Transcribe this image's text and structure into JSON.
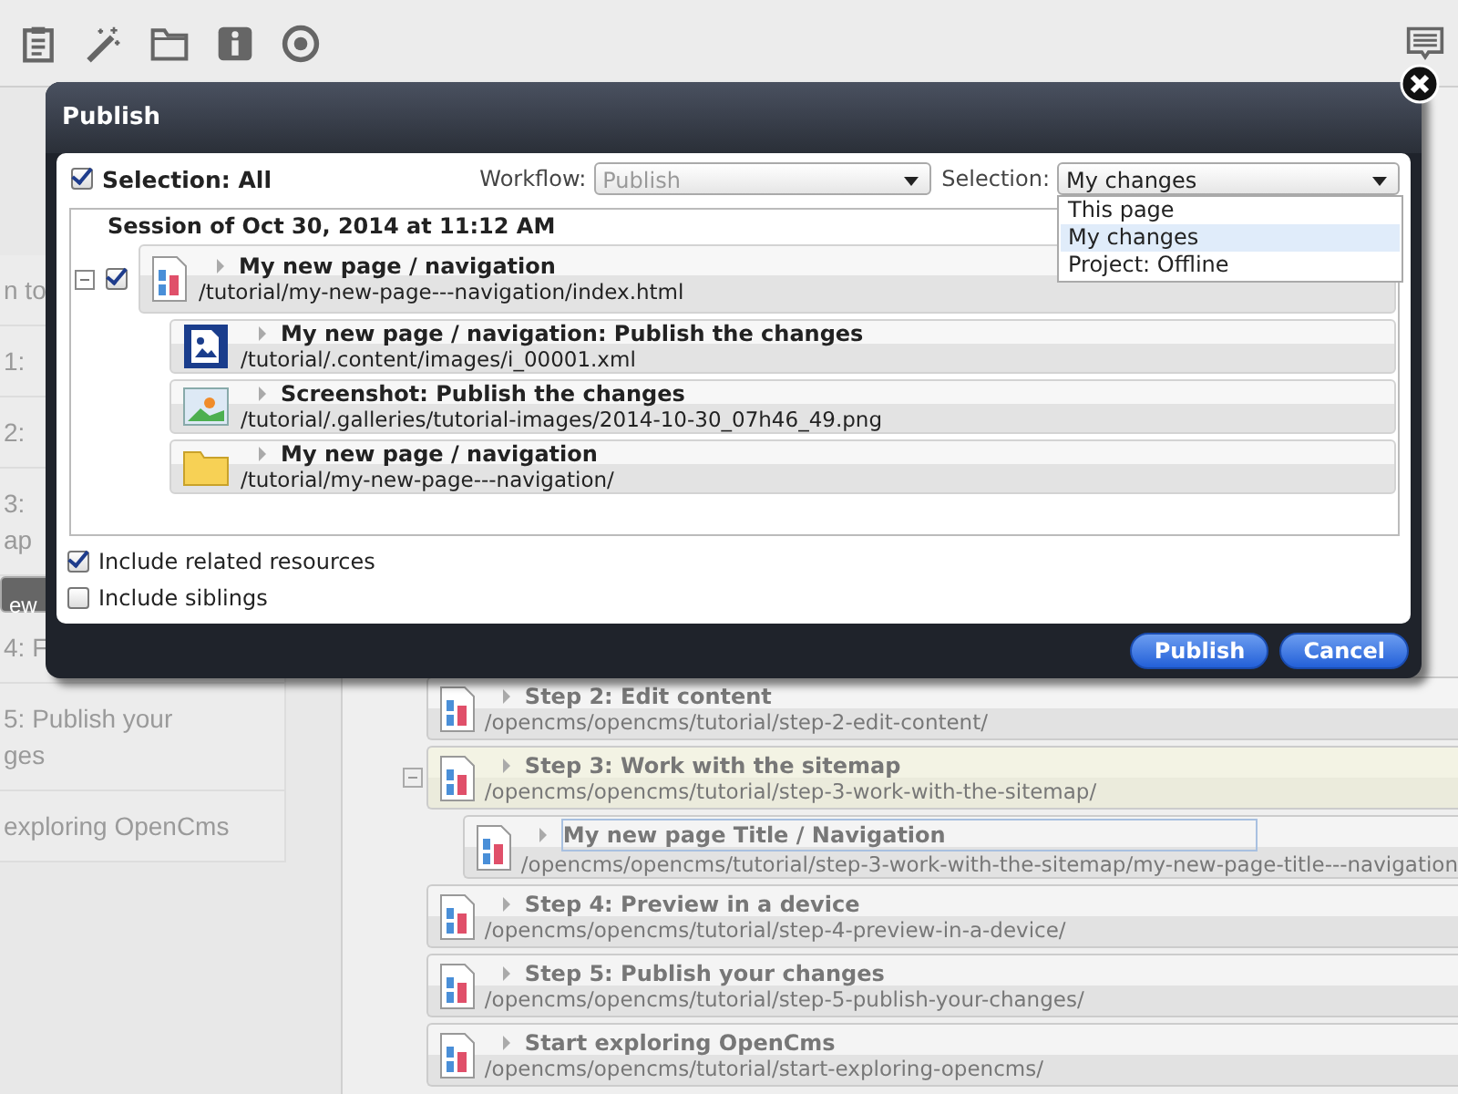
{
  "sidebar": {
    "items": [
      {
        "lines": [
          "n to"
        ],
        "selected": false
      },
      {
        "lines": [
          "1:"
        ],
        "selected": false
      },
      {
        "lines": [
          "2:"
        ],
        "selected": false
      },
      {
        "lines": [
          "3:",
          "ap"
        ],
        "selected": false
      },
      {
        "lines": [
          "ew"
        ],
        "selected": true
      },
      {
        "lines": [
          "4: F"
        ],
        "selected": false
      },
      {
        "lines": [
          "5: Publish your",
          "ges"
        ],
        "selected": false
      },
      {
        "lines": [
          "exploring OpenCms"
        ],
        "selected": false
      }
    ]
  },
  "sitemap": {
    "items": [
      {
        "title": "Step 2: Edit content",
        "path": "/opencms/opencms/tutorial/step-2-edit-content/",
        "expanded": false,
        "highlighted": false
      },
      {
        "title": "Step 3: Work with the sitemap",
        "path": "/opencms/opencms/tutorial/step-3-work-with-the-sitemap/",
        "expanded": true,
        "highlighted": true,
        "children": [
          {
            "title": "My new page Title / Navigation",
            "path": "/opencms/opencms/tutorial/step-3-work-with-the-sitemap/my-new-page-title---navigation",
            "editing": true
          }
        ]
      },
      {
        "title": "Step 4: Preview in a device",
        "path": "/opencms/opencms/tutorial/step-4-preview-in-a-device/",
        "expanded": false,
        "highlighted": false
      },
      {
        "title": "Step 5: Publish your changes",
        "path": "/opencms/opencms/tutorial/step-5-publish-your-changes/",
        "expanded": false,
        "highlighted": false
      },
      {
        "title": "Start exploring OpenCms",
        "path": "/opencms/opencms/tutorial/start-exploring-opencms/",
        "expanded": false,
        "highlighted": false
      }
    ]
  },
  "dialog": {
    "title": "Publish",
    "select_all": {
      "label": "Selection: All",
      "checked": true
    },
    "workflow": {
      "label": "Workflow:",
      "value": "Publish",
      "disabled": true
    },
    "selection": {
      "label": "Selection:",
      "value": "My changes",
      "options": [
        {
          "label": "This page",
          "selected": false
        },
        {
          "label": "My changes",
          "selected": true
        },
        {
          "label": "Project: Offline",
          "selected": false
        }
      ]
    },
    "session": {
      "title": "Session of Oct 30, 2014 at 11:12 AM",
      "expanded": true,
      "checked": true,
      "resource": {
        "kind": "page",
        "title": "My new page / navigation",
        "path": "/tutorial/my-new-page---navigation/index.html"
      },
      "related": [
        {
          "kind": "xml",
          "title": "My new page / navigation: Publish the changes",
          "path": "/tutorial/.content/images/i_00001.xml"
        },
        {
          "kind": "image",
          "title": "Screenshot: Publish the changes",
          "path": "/tutorial/.galleries/tutorial-images/2014-10-30_07h46_49.png"
        },
        {
          "kind": "folder",
          "title": "My new page / navigation",
          "path": "/tutorial/my-new-page---navigation/"
        }
      ]
    },
    "options": [
      {
        "label": "Include related resources",
        "checked": true
      },
      {
        "label": "Include siblings",
        "checked": false
      }
    ],
    "buttons": [
      "Publish",
      "Cancel"
    ]
  }
}
